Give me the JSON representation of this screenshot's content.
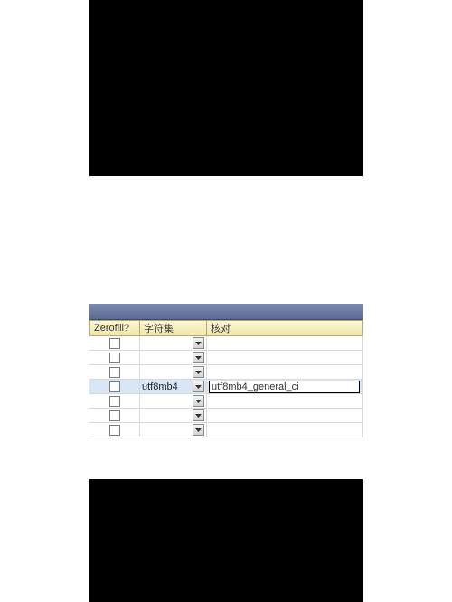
{
  "columns": {
    "zerofill": "Zerofill?",
    "charset": "字符集",
    "collation": "核对"
  },
  "rows": [
    {
      "zerofill": false,
      "charset": "",
      "collation": "",
      "selected": false
    },
    {
      "zerofill": false,
      "charset": "",
      "collation": "",
      "selected": false
    },
    {
      "zerofill": false,
      "charset": "",
      "collation": "",
      "selected": false
    },
    {
      "zerofill": false,
      "charset": "utf8mb4",
      "collation": "utf8mb4_general_ci",
      "selected": true,
      "editing": true
    },
    {
      "zerofill": false,
      "charset": "",
      "collation": "",
      "selected": false
    },
    {
      "zerofill": false,
      "charset": "",
      "collation": "",
      "selected": false
    },
    {
      "zerofill": false,
      "charset": "",
      "collation": "",
      "selected": false
    }
  ]
}
